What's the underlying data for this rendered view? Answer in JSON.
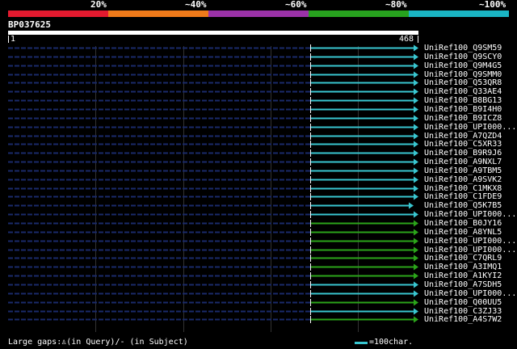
{
  "legend": {
    "labels": [
      "20%",
      "~40%",
      "~60%",
      "~80%",
      "~100%"
    ],
    "colors": [
      "#e31a2f",
      "#ef7a1a",
      "#9b32a8",
      "#27a21e",
      "#1ab5c4"
    ]
  },
  "query": {
    "name": "BP037625",
    "start": "1",
    "end": "468"
  },
  "hit_colors": {
    "cyan": "#39c6d0",
    "green": "#2ba41a",
    "dashed": "#1a2a6a"
  },
  "hits": [
    {
      "label": "UniRef100_Q9SM59",
      "color": "cyan"
    },
    {
      "label": "UniRef100_Q9SCY0",
      "color": "cyan"
    },
    {
      "label": "UniRef100_Q9M4G5",
      "color": "cyan"
    },
    {
      "label": "UniRef100_Q9SMM0",
      "color": "cyan"
    },
    {
      "label": "UniRef100_Q53QR8",
      "color": "cyan"
    },
    {
      "label": "UniRef100_Q33AE4",
      "color": "cyan"
    },
    {
      "label": "UniRef100_B8BG13",
      "color": "cyan"
    },
    {
      "label": "UniRef100_B9I4H0",
      "color": "cyan"
    },
    {
      "label": "UniRef100_B9ICZ8",
      "color": "cyan"
    },
    {
      "label": "UniRef100_UPI000...",
      "color": "cyan"
    },
    {
      "label": "UniRef100_A7QZD4",
      "color": "cyan"
    },
    {
      "label": "UniRef100_C5XR33",
      "color": "cyan"
    },
    {
      "label": "UniRef100_B9R9J6",
      "color": "cyan"
    },
    {
      "label": "UniRef100_A9NXL7",
      "color": "cyan"
    },
    {
      "label": "UniRef100_A9TBM5",
      "color": "cyan"
    },
    {
      "label": "UniRef100_A9SVK2",
      "color": "cyan"
    },
    {
      "label": "UniRef100_C1MKX8",
      "color": "cyan"
    },
    {
      "label": "UniRef100_C1FDE9",
      "color": "cyan"
    },
    {
      "label": "UniRef100_Q5K7B5",
      "color": "cyan"
    },
    {
      "label": "UniRef100_UPI000...",
      "color": "cyan"
    },
    {
      "label": "UniRef100_B0JY16",
      "color": "green"
    },
    {
      "label": "UniRef100_A8YNL5",
      "color": "green"
    },
    {
      "label": "UniRef100_UPI000...",
      "color": "green"
    },
    {
      "label": "UniRef100_UPI000...",
      "color": "green"
    },
    {
      "label": "UniRef100_C7QRL9",
      "color": "green"
    },
    {
      "label": "UniRef100_A3IMQ1",
      "color": "green"
    },
    {
      "label": "UniRef100_A1KYI2",
      "color": "green"
    },
    {
      "label": "UniRef100_A7SDH5",
      "color": "cyan"
    },
    {
      "label": "UniRef100_UPI000...",
      "color": "cyan"
    },
    {
      "label": "UniRef100_Q00UU5",
      "color": "green"
    },
    {
      "label": "UniRef100_C3ZJ33",
      "color": "cyan"
    },
    {
      "label": "UniRef100_A4S7W2",
      "color": "green"
    }
  ],
  "footer": {
    "gaps_text": "Large gaps:♙(in Query)/- (in Subject)",
    "scale_text": "=100char."
  }
}
